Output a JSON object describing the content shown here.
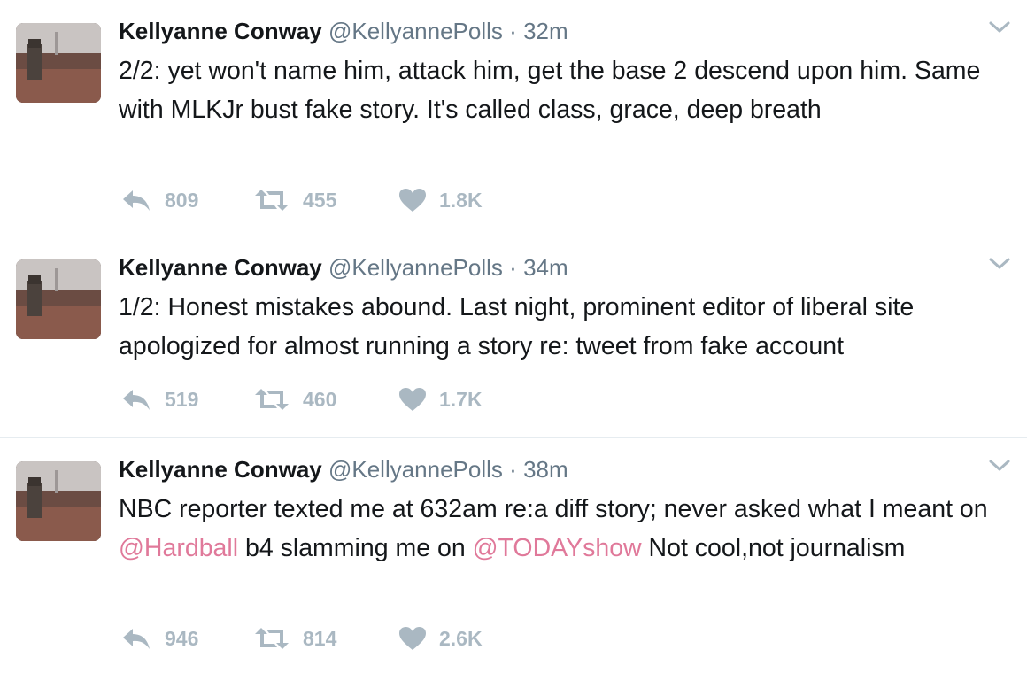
{
  "colors": {
    "mention": "#e0799a",
    "muted": "#657786",
    "action": "#aab8c2"
  },
  "tweets": [
    {
      "name": "Kellyanne Conway",
      "handle": "@KellyannePolls",
      "separator": "·",
      "time": "32m",
      "text_parts": [
        {
          "text": "2/2: yet won't name him, attack him, get the base 2 descend upon him. Same with MLKJr bust fake story. It's called class, grace, deep breath",
          "mention": false
        }
      ],
      "replies": "809",
      "retweets": "455",
      "likes": "1.8K"
    },
    {
      "name": "Kellyanne Conway",
      "handle": "@KellyannePolls",
      "separator": "·",
      "time": "34m",
      "text_parts": [
        {
          "text": "1/2: Honest mistakes abound. Last night, prominent editor of liberal site apologized for almost running a story re: tweet from fake account",
          "mention": false
        }
      ],
      "replies": "519",
      "retweets": "460",
      "likes": "1.7K"
    },
    {
      "name": "Kellyanne Conway",
      "handle": "@KellyannePolls",
      "separator": "·",
      "time": "38m",
      "text_parts": [
        {
          "text": "NBC reporter texted me at 632am re:a diff story; never asked what I meant on ",
          "mention": false
        },
        {
          "text": "@Hardball",
          "mention": true
        },
        {
          "text": " b4 slamming me on ",
          "mention": false
        },
        {
          "text": "@TODAYshow",
          "mention": true
        },
        {
          "text": " Not cool,not journalism",
          "mention": false
        }
      ],
      "replies": "946",
      "retweets": "814",
      "likes": "2.6K"
    }
  ],
  "icons": {
    "avatar": "avatar-photo",
    "caret": "chevron-down-icon",
    "reply": "reply-icon",
    "retweet": "retweet-icon",
    "like": "heart-icon"
  }
}
